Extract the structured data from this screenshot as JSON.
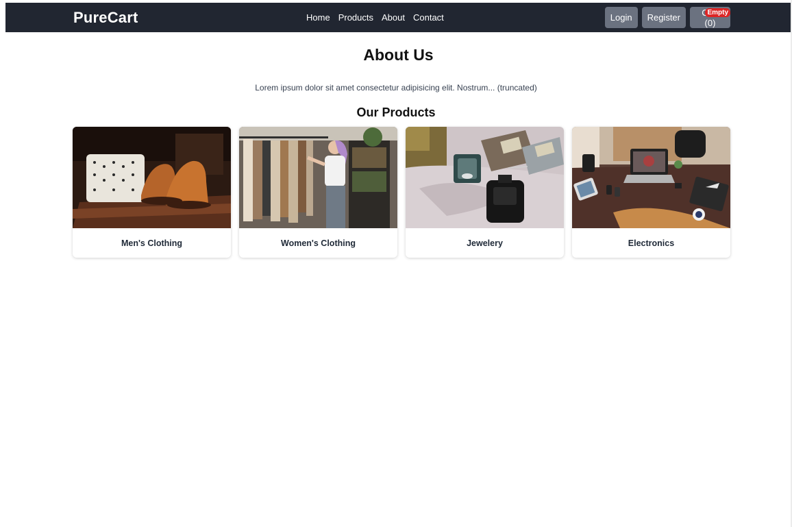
{
  "navbar": {
    "brand": "PureCart",
    "links": [
      "Home",
      "Products",
      "About",
      "Contact"
    ],
    "login_label": "Login",
    "register_label": "Register",
    "cart_label": "Cart (0)",
    "cart_badge": "Empty"
  },
  "colors": {
    "navbar_bg": "#212631",
    "button_bg": "#6b7280",
    "badge_bg": "#dc2626"
  },
  "main": {
    "title": "About Us",
    "about_text": "Lorem ipsum dolor sit amet consectetur adipisicing elit. Nostrum... (truncated)",
    "products_title": "Our Products",
    "categories": [
      {
        "label": "Men's Clothing",
        "image": "mens-clothing-photo"
      },
      {
        "label": "Women's Clothing",
        "image": "womens-clothing-photo"
      },
      {
        "label": "Jewelery",
        "image": "jewelery-photo"
      },
      {
        "label": "Electronics",
        "image": "electronics-photo"
      }
    ]
  }
}
